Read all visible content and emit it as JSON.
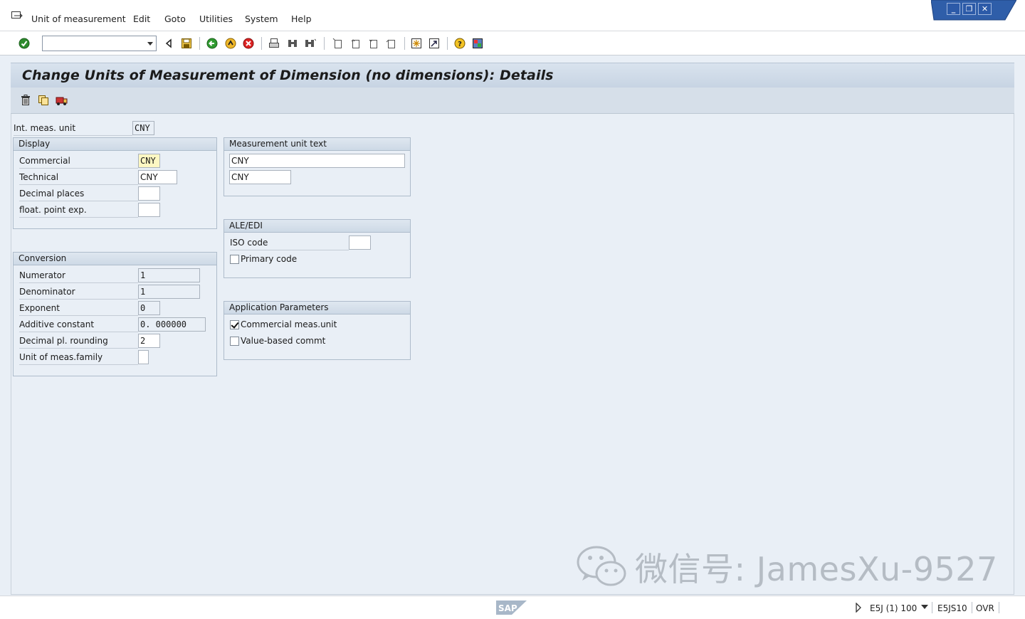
{
  "menu": {
    "items": [
      "Unit of measurement",
      "Edit",
      "Goto",
      "Utilities",
      "System",
      "Help"
    ]
  },
  "window_controls": [
    "minimize",
    "restore",
    "close"
  ],
  "toolbar": {
    "command_field_value": "",
    "icons": [
      "enter-check",
      "command-dropdown",
      "back-triangle",
      "save",
      "back-green",
      "exit-yellow",
      "cancel-red",
      "print",
      "find",
      "find-next",
      "first-page",
      "previous-page",
      "next-page",
      "last-page",
      "create-session",
      "shortcut",
      "help",
      "customize-layout"
    ]
  },
  "page_title": "Change Units of Measurement of Dimension (no dimensions): Details",
  "app_toolbar": {
    "icons": [
      "delete-icon",
      "copy-icon",
      "transport-icon"
    ]
  },
  "int_meas_unit": {
    "label": "Int. meas. unit",
    "value": "CNY"
  },
  "display": {
    "title": "Display",
    "commercial": {
      "label": "Commercial",
      "value": "CNY"
    },
    "technical": {
      "label": "Technical",
      "value": "CNY"
    },
    "decimal_places": {
      "label": "Decimal places",
      "value": ""
    },
    "float_point_exp": {
      "label": "float. point exp.",
      "value": ""
    }
  },
  "measurement_text": {
    "title": "Measurement unit text",
    "long_text": "CNY",
    "short_text": "CNY"
  },
  "conversion": {
    "title": "Conversion",
    "numerator": {
      "label": "Numerator",
      "value": "1"
    },
    "denominator": {
      "label": "Denominator",
      "value": "1"
    },
    "exponent": {
      "label": "Exponent",
      "value": "0"
    },
    "additive_constant": {
      "label": "Additive constant",
      "value": "0. 000000"
    },
    "decimal_rounding": {
      "label": "Decimal pl. rounding",
      "value": "2"
    },
    "family": {
      "label": "Unit of meas.family",
      "value": ""
    }
  },
  "ale_edi": {
    "title": "ALE/EDI",
    "iso_code": {
      "label": "ISO code",
      "value": ""
    },
    "primary_code": {
      "label": "Primary code",
      "checked": false
    }
  },
  "app_params": {
    "title": "Application Parameters",
    "commercial_unit": {
      "label": "Commercial meas.unit",
      "checked": true
    },
    "value_based": {
      "label": "Value-based commt",
      "checked": false
    }
  },
  "status_bar": {
    "system_info": "E5J (1) 100",
    "server": "E5JS10",
    "mode": "OVR"
  },
  "watermark": {
    "text": "微信号: JamesXu-9527"
  },
  "colors": {
    "title_bg": "#c7d4e3",
    "body_bg": "#e9eff6",
    "highlight_field": "#fdf7c3",
    "window_buttons": "#2c5aa8"
  }
}
